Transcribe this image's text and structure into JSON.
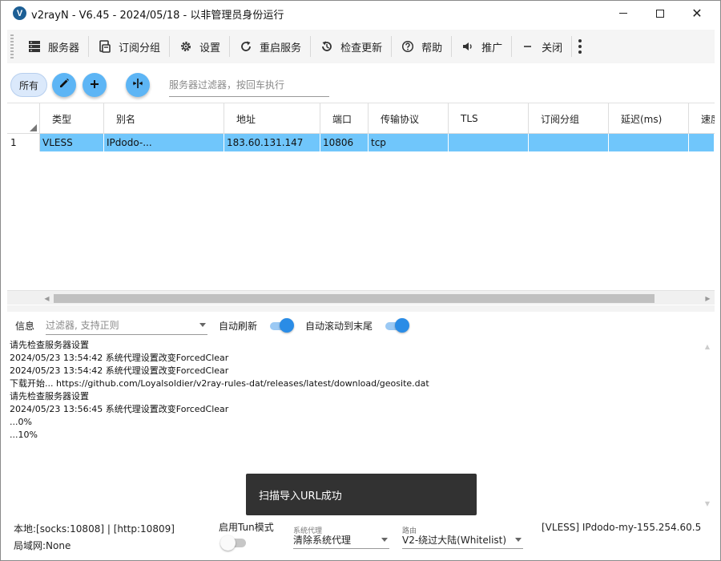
{
  "window": {
    "title": "v2rayN - V6.45 - 2024/05/18 - 以非管理员身份运行",
    "logo_letter": "V",
    "minimize_icon": "minimize-icon",
    "maximize_icon": "maximize-icon",
    "close_glyph": "✕"
  },
  "toolbar": {
    "items": [
      {
        "label": "服务器",
        "icon": "server-icon"
      },
      {
        "label": "订阅分组",
        "icon": "subscription-icon"
      },
      {
        "label": "设置",
        "icon": "gear-icon"
      },
      {
        "label": "重启服务",
        "icon": "restart-icon"
      },
      {
        "label": "检查更新",
        "icon": "update-icon"
      },
      {
        "label": "帮助",
        "icon": "help-icon"
      },
      {
        "label": "推广",
        "icon": "speaker-icon"
      },
      {
        "label": "关闭",
        "icon": "minus-icon"
      }
    ],
    "more_icon": "more-vertical-icon"
  },
  "filter": {
    "all_label": "所有",
    "server_filter_placeholder": "服务器过滤器，按回车执行"
  },
  "grid": {
    "columns": [
      "类型",
      "别名",
      "地址",
      "端口",
      "传输协议",
      "TLS",
      "订阅分组",
      "延迟(ms)",
      "速度"
    ],
    "rows": [
      {
        "index": "1",
        "type": "VLESS",
        "alias": "IPdodo-...",
        "address": "183.60.131.147",
        "port": "10806",
        "network": "tcp",
        "tls": "",
        "subgroup": "",
        "delay": "",
        "speed": ""
      }
    ]
  },
  "log": {
    "label": "信息",
    "filter_placeholder": "过滤器, 支持正则",
    "auto_refresh_label": "自动刷新",
    "auto_refresh_on": true,
    "auto_scroll_label": "自动滚动到末尾",
    "auto_scroll_on": true,
    "lines": [
      "请先检查服务器设置",
      "2024/05/23 13:54:42 系统代理设置改变ForcedClear",
      "2024/05/23 13:54:42 系统代理设置改变ForcedClear",
      "下载开始...   https://github.com/Loyalsoldier/v2ray-rules-dat/releases/latest/download/geosite.dat",
      "请先检查服务器设置",
      "2024/05/23 13:56:45 系统代理设置改变ForcedClear",
      "...0%",
      "...10%"
    ]
  },
  "toast": {
    "message": "扫描导入URL成功"
  },
  "status": {
    "local": "本地:[socks:10808] | [http:10809]",
    "lan": "局域网:None",
    "tun_label": "启用Tun模式",
    "tun_on": false,
    "sysproxy_caption": "系统代理",
    "sysproxy_value": "清除系统代理",
    "routing_caption": "路由",
    "routing_value": "V2-绕过大陆(Whitelist)",
    "current_server": "[VLESS] IPdodo-my-155.254.60.5"
  },
  "colors": {
    "accent": "#2a8ce6",
    "fab": "#5db5f5",
    "selected_row": "#70c6fb",
    "toast_bg": "#323232"
  }
}
